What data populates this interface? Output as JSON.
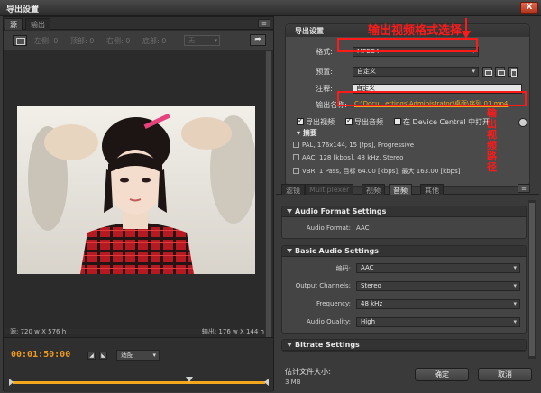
{
  "window": {
    "title": "导出设置",
    "close_label": "X"
  },
  "left_panel": {
    "tabs": [
      "源",
      "输出"
    ],
    "menu_icon": "≡",
    "crop": {
      "left": "左侧: 0",
      "top": "顶部: 0",
      "right": "右侧: 0",
      "bottom": "底部: 0",
      "aspect": "无",
      "arrow": "➦"
    },
    "source_size": "源: 720 w X 576 h",
    "output_size": "输出: 176 w X 144 h",
    "timecode": "00:01:50:00",
    "fit": "适配",
    "playhead_fraction": 0.7
  },
  "export_settings": {
    "header": "导出设置",
    "format_label": "格式:",
    "format_value": "MPEG4",
    "preset_label": "预置:",
    "preset_value": "自定义",
    "comment_label": "注释:",
    "comment_value": "自定义",
    "output_name_label": "输出名称:",
    "output_name_value": "C:\\Docu...ettings\\Administrator\\桌面\\序列 01.mp4",
    "export_video": "导出视频",
    "export_audio": "导出音频",
    "device_central": "在 Device Central 中打开",
    "summary_title": "摘要",
    "summary_lines": [
      "PAL, 176x144, 15 [fps], Progressive",
      "AAC, 128 [kbps], 48 kHz, Stereo",
      "VBR, 1 Pass, 目标 64.00 [kbps], 最大 163.00 [kbps]"
    ]
  },
  "tabs": [
    "滤镜",
    "Multiplexer",
    "视频",
    "音频",
    "其他"
  ],
  "audio_format": {
    "header": "Audio Format Settings",
    "label": "Audio Format:",
    "value": "AAC"
  },
  "basic_audio": {
    "header": "Basic Audio Settings",
    "codec_label": "编码:",
    "codec_value": "AAC",
    "channels_label": "Output Channels:",
    "channels_value": "Stereo",
    "frequency_label": "Frequency:",
    "frequency_value": "48 kHz",
    "quality_label": "Audio Quality:",
    "quality_value": "High"
  },
  "bitrate": {
    "header": "Bitrate Settings"
  },
  "footer": {
    "est_label": "估计文件大小:",
    "est_value": "3 MB",
    "ok": "确定",
    "cancel": "取消"
  },
  "annotations": {
    "format_note": "输出视频格式选择",
    "path_note": "输出视频路径"
  },
  "colors": {
    "accent": "#f3a71c",
    "annotation": "#ff1a1a"
  }
}
